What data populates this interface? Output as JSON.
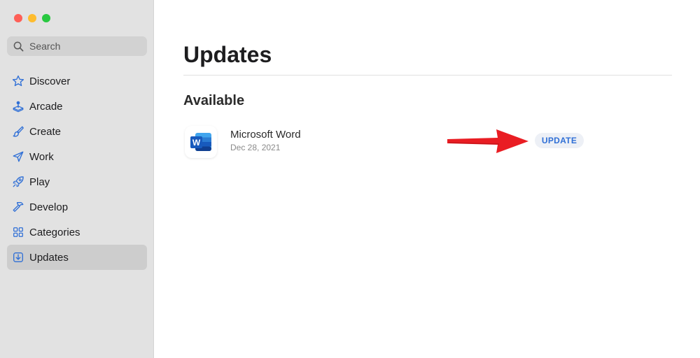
{
  "colors": {
    "accent": "#2f6fd6",
    "traffic_close": "#fe5f57",
    "traffic_minimize": "#febc2e",
    "traffic_zoom": "#28c840",
    "arrow": "#e8141a",
    "word_blue": "#185abd"
  },
  "search": {
    "placeholder": "Search",
    "icon": "magnifying-glass-icon"
  },
  "sidebar": {
    "items": [
      {
        "label": "Discover",
        "icon": "star-icon"
      },
      {
        "label": "Arcade",
        "icon": "joystick-icon"
      },
      {
        "label": "Create",
        "icon": "paintbrush-icon"
      },
      {
        "label": "Work",
        "icon": "paper-plane-icon"
      },
      {
        "label": "Play",
        "icon": "rocket-icon"
      },
      {
        "label": "Develop",
        "icon": "hammer-icon"
      },
      {
        "label": "Categories",
        "icon": "grid-icon"
      },
      {
        "label": "Updates",
        "icon": "download-icon",
        "selected": true
      }
    ]
  },
  "main": {
    "title": "Updates",
    "section": "Available",
    "apps": [
      {
        "name": "Microsoft Word",
        "date": "Dec 28, 2021",
        "icon": "microsoft-word-icon",
        "icon_letter": "W",
        "action": "UPDATE"
      }
    ]
  }
}
